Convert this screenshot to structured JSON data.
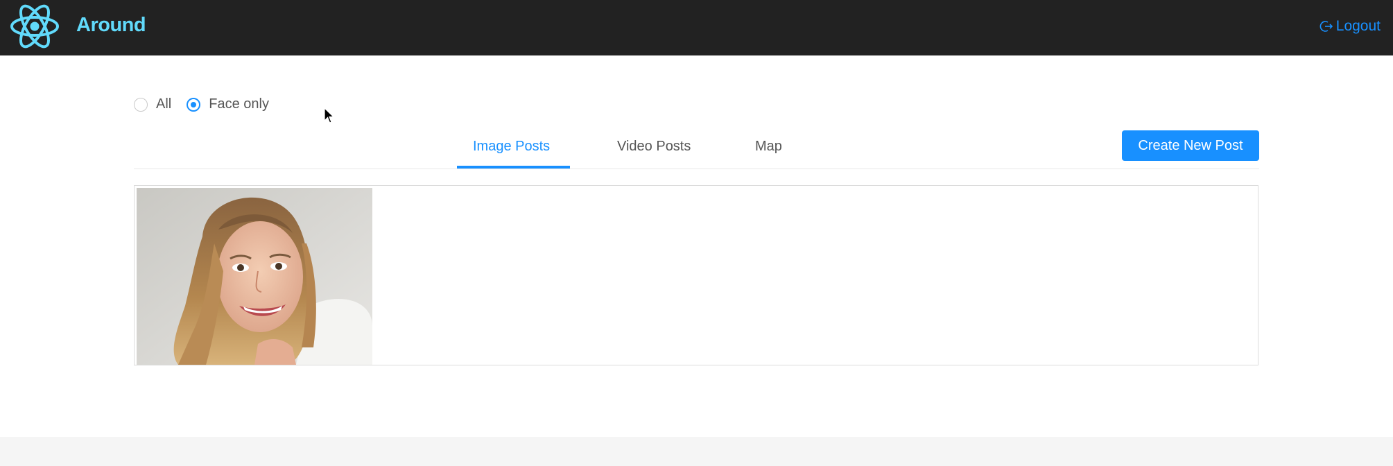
{
  "header": {
    "app_title": "Around",
    "logo_icon": "react-atom-icon",
    "logout_label": "Logout",
    "logout_icon": "logout-icon",
    "background_color": "#222222",
    "title_color": "#61dafb",
    "link_color": "#1890ff"
  },
  "filter": {
    "options": [
      {
        "label": "All",
        "checked": false
      },
      {
        "label": "Face only",
        "checked": true
      }
    ]
  },
  "tabs": [
    {
      "label": "Image Posts",
      "active": true
    },
    {
      "label": "Video Posts",
      "active": false
    },
    {
      "label": "Map",
      "active": false
    }
  ],
  "actions": {
    "create_post_label": "Create New Post"
  },
  "gallery": {
    "items": [
      {
        "kind": "image",
        "subject": "smiling-woman-portrait"
      }
    ]
  },
  "accent_color": "#1890ff"
}
